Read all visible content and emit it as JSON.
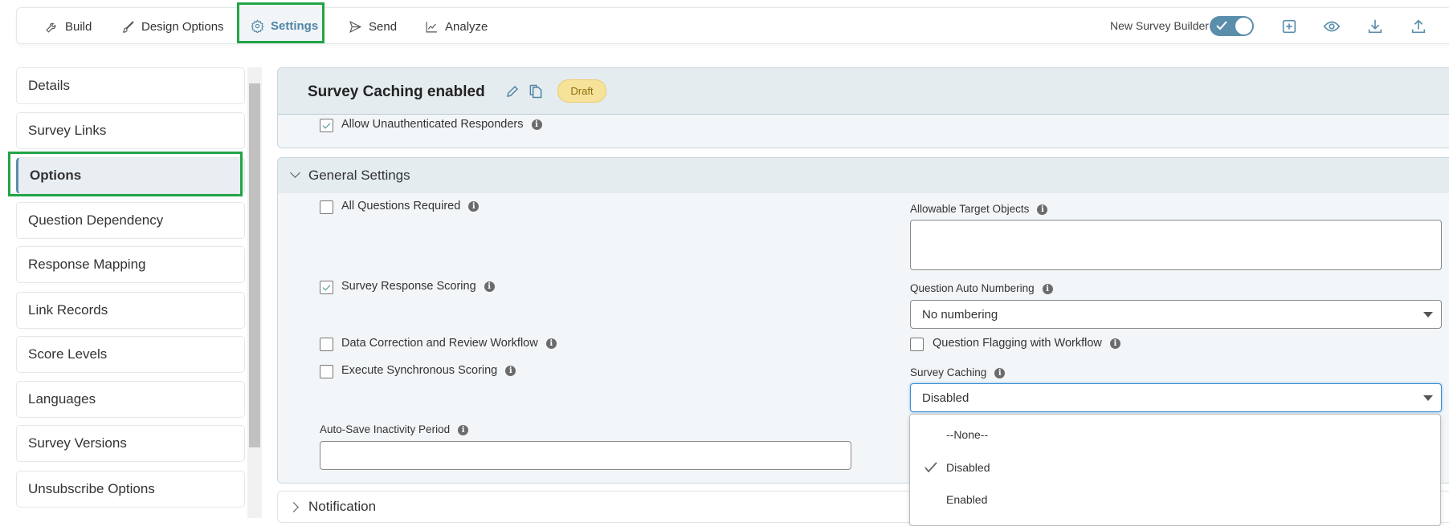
{
  "toolbar": {
    "tabs": [
      {
        "label": "Build",
        "icon": "wrench-icon"
      },
      {
        "label": "Design Options",
        "icon": "brush-icon"
      },
      {
        "label": "Settings",
        "icon": "gear-icon",
        "active": true
      },
      {
        "label": "Send",
        "icon": "send-icon"
      },
      {
        "label": "Analyze",
        "icon": "chart-icon"
      }
    ],
    "new_builder_label": "New Survey Builder",
    "new_builder_enabled": true,
    "accent": "#5a8eab"
  },
  "sidebar": {
    "items": [
      {
        "label": "Details"
      },
      {
        "label": "Survey Links"
      },
      {
        "label": "Options",
        "active": true
      },
      {
        "label": "Question Dependency"
      },
      {
        "label": "Response Mapping"
      },
      {
        "label": "Link Records"
      },
      {
        "label": "Score Levels"
      },
      {
        "label": "Languages"
      },
      {
        "label": "Survey Versions"
      },
      {
        "label": "Unsubscribe Options"
      }
    ]
  },
  "header": {
    "title": "Survey Caching enabled",
    "status": "Draft"
  },
  "top_section": {
    "allow_unauth": {
      "label": "Allow Unauthenticated Responders",
      "checked": true
    }
  },
  "general": {
    "title": "General Settings",
    "all_required": {
      "label": "All Questions Required",
      "checked": false
    },
    "response_scoring": {
      "label": "Survey Response Scoring",
      "checked": true
    },
    "data_correction": {
      "label": "Data Correction and Review Workflow",
      "checked": false
    },
    "sync_scoring": {
      "label": "Execute Synchronous Scoring",
      "checked": false
    },
    "autosave": {
      "label": "Auto-Save Inactivity Period",
      "value": ""
    },
    "target_objects": {
      "label": "Allowable Target Objects",
      "value": ""
    },
    "auto_numbering": {
      "label": "Question Auto Numbering",
      "value": "No numbering"
    },
    "flagging": {
      "label": "Question Flagging with Workflow",
      "checked": false
    },
    "caching": {
      "label": "Survey Caching",
      "value": "Disabled",
      "options": [
        {
          "label": "--None--"
        },
        {
          "label": "Disabled",
          "selected": true
        },
        {
          "label": "Enabled"
        }
      ]
    }
  },
  "notification": {
    "title": "Notification"
  }
}
